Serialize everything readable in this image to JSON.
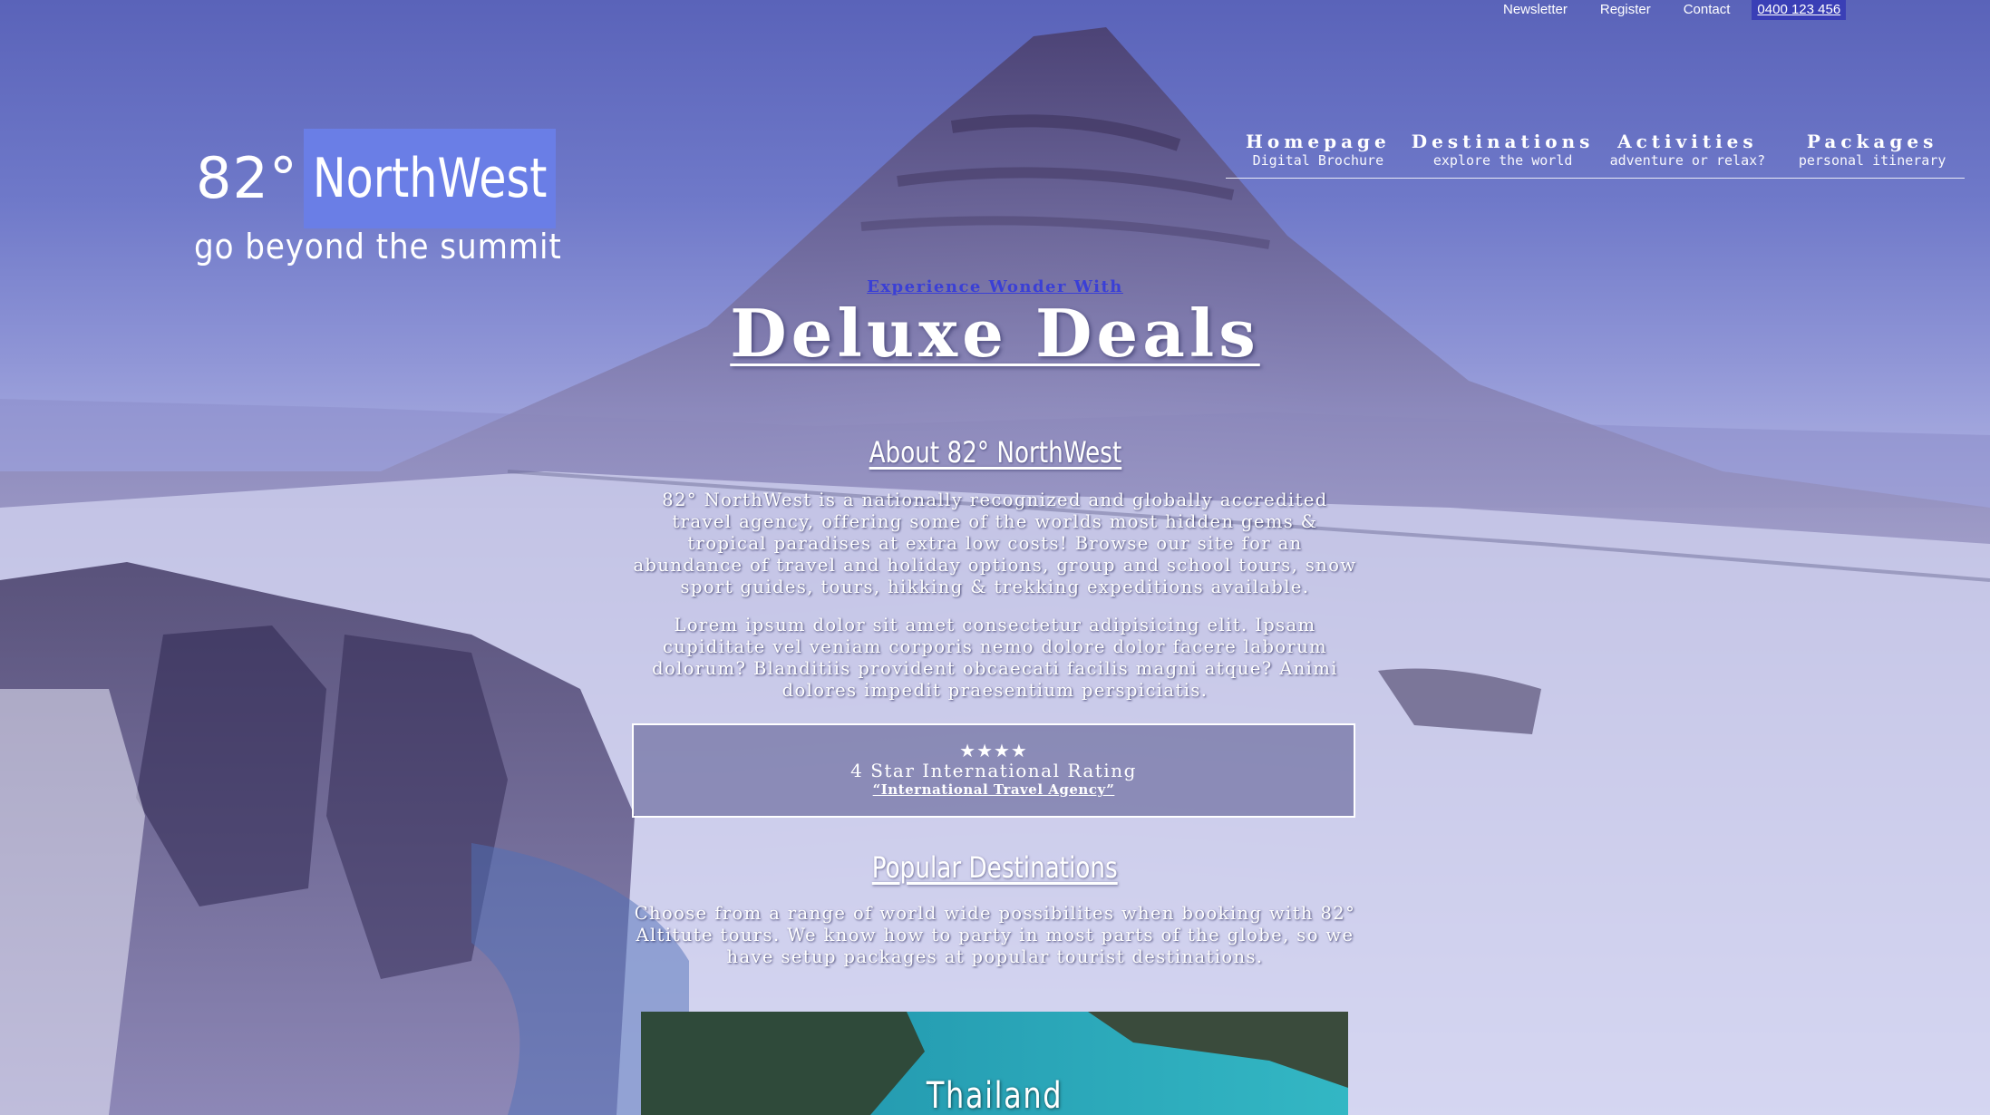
{
  "topbar": {
    "newsletter": "Newsletter",
    "register": "Register",
    "contact": "Contact",
    "phone": "0400 123 456"
  },
  "logo": {
    "degrees": "82°",
    "name": "NorthWest",
    "tagline": "go beyond the summit"
  },
  "nav": {
    "items": [
      {
        "title": "Homepage",
        "subtitle": "Digital Brochure"
      },
      {
        "title": "Destinations",
        "subtitle": "explore the world"
      },
      {
        "title": "Activities",
        "subtitle": "adventure or relax?"
      },
      {
        "title": "Packages",
        "subtitle": "personal itinerary"
      }
    ]
  },
  "hero": {
    "kicker": "Experience Wonder With",
    "title": "Deluxe Deals"
  },
  "about": {
    "heading": "About 82° NorthWest",
    "paragraph1": "82° NorthWest is a nationally recognized and globally accredited travel agency, offering some of the worlds most hidden gems & tropical paradises at extra low costs! Browse our site for an abundance of travel and holiday options, group and school tours, snow sport guides, tours, hikking & trekking expeditions available.",
    "paragraph2": "Lorem ipsum dolor sit amet consectetur adipisicing elit. Ipsam cupiditate vel veniam corporis nemo dolore dolor facere laborum dolorum? Blanditiis provident obcaecati facilis magni atque? Animi dolores impedit praesentium perspiciatis."
  },
  "rating": {
    "stars": "★★★★",
    "stars_value": 4,
    "text": "4 Star International Rating",
    "subtitle": "“International Travel Agency”"
  },
  "popular": {
    "heading": "Popular Destinations",
    "paragraph": "Choose from a range of world wide possibilites when booking with 82° Altitute tours. We know how to party in most parts of the globe, so we have setup packages at popular tourist destinations."
  },
  "destination_card": {
    "label": "Thailand"
  }
}
